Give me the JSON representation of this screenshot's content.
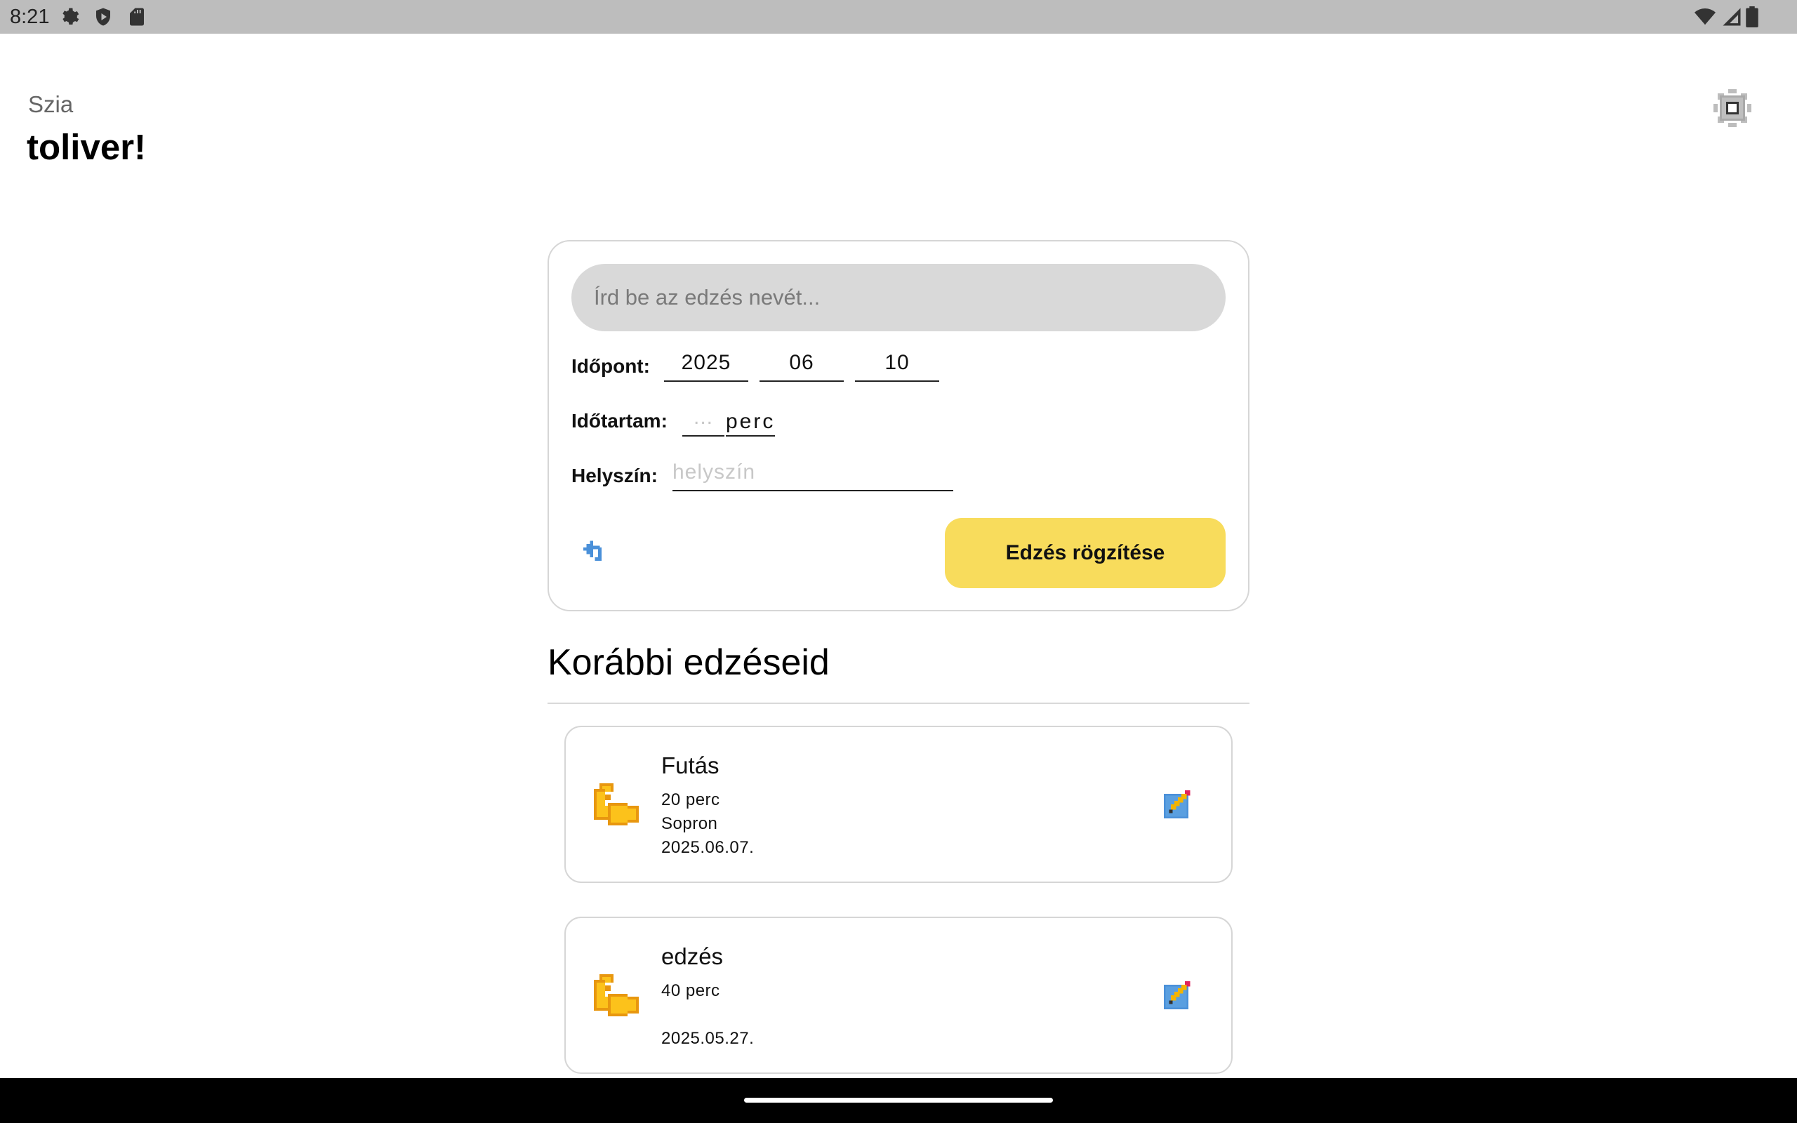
{
  "status_bar": {
    "time": "8:21",
    "left_icons": [
      "settings-icon",
      "shield-play-icon",
      "sd-card-icon"
    ],
    "right_icons": [
      "wifi-icon",
      "signal-icon",
      "battery-icon"
    ]
  },
  "header": {
    "greeting": "Szia",
    "username": "toliver!",
    "settings_icon": "gear-icon"
  },
  "form": {
    "name_placeholder": "Írd be az edzés nevét...",
    "date_label": "Időpont:",
    "date_year": "2025",
    "date_month": "06",
    "date_day": "10",
    "duration_label": "Időtartam:",
    "duration_placeholder": "...",
    "duration_unit": "perc",
    "location_label": "Helyszín:",
    "location_placeholder": "helyszín",
    "undo_icon": "undo-icon",
    "submit_label": "Edzés rögzítése",
    "accent_color": "#f8dc5c"
  },
  "history": {
    "title": "Korábbi edzéseid",
    "items": [
      {
        "icon": "flexed-biceps-icon",
        "title": "Futás",
        "duration": "20 perc",
        "location": "Sopron",
        "date": "2025.06.07."
      },
      {
        "icon": "flexed-biceps-icon",
        "title": "edzés",
        "duration": "40 perc",
        "location": "",
        "date": "2025.05.27."
      }
    ]
  }
}
